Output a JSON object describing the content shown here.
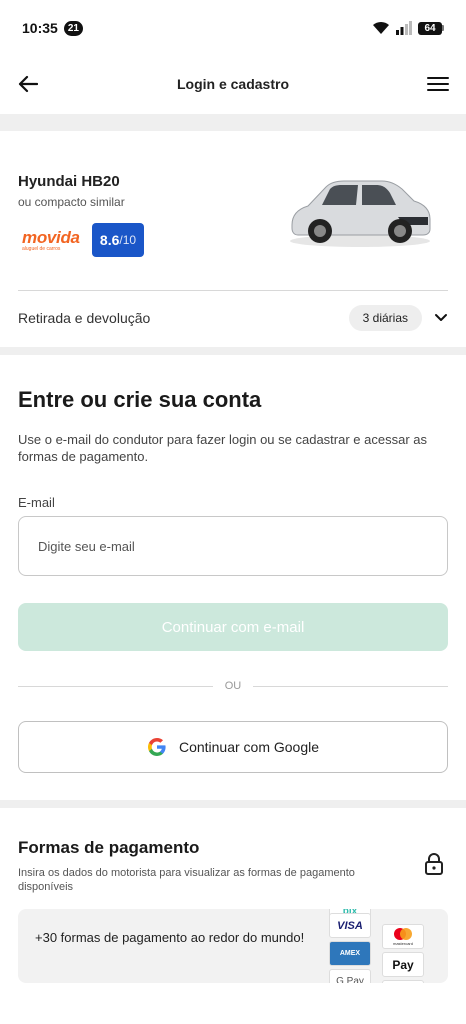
{
  "status_bar": {
    "time": "10:35",
    "notification_count": "21",
    "battery": "64"
  },
  "header": {
    "title": "Login e cadastro"
  },
  "car": {
    "name": "Hyundai HB20",
    "subtitle": "ou compacto similar",
    "brand_logo": "movida",
    "brand_tagline": "aluguel de carros",
    "rating": "8.6",
    "rating_max": "/10",
    "pickup_label": "Retirada e devolução",
    "days": "3 diárias"
  },
  "login": {
    "title": "Entre ou crie sua conta",
    "description": "Use o e-mail do condutor para fazer login ou se cadastrar e acessar as formas de pagamento.",
    "email_label": "E-mail",
    "email_placeholder": "Digite seu e-mail",
    "email_value": "",
    "continue_email_label": "Continuar com e-mail",
    "or_text": "OU",
    "google_label": "Continuar com Google"
  },
  "payment": {
    "title": "Formas de pagamento",
    "description": "Insira os dados do motorista para visualizar as formas de pagamento disponíveis",
    "card_text": "+30 formas de pagamento ao redor do mundo!",
    "logos": [
      "VISA",
      "AMEX",
      "G Pay",
      "pix",
      "mastercard",
      "Pay"
    ]
  },
  "colors": {
    "accent_green_disabled": "#cce8dc",
    "score_blue": "#1a56c8",
    "brand_orange": "#f26522",
    "section_gap": "#efefef"
  }
}
